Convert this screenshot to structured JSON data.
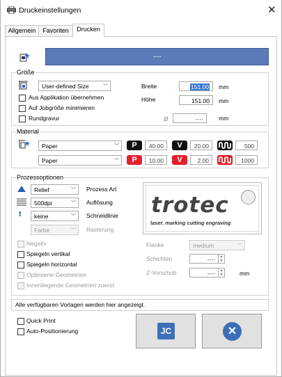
{
  "window": {
    "title": "Druckeinstellungen"
  },
  "tabs": [
    {
      "label": "Allgemein",
      "active": false
    },
    {
      "label": "Favoriten",
      "active": false
    },
    {
      "label": "Drucken",
      "active": true
    }
  ],
  "job": {
    "name": "----"
  },
  "groesse": {
    "title": "Größe",
    "size_preset": "User-defined Size",
    "breite_label": "Breite",
    "breite_value": "151.00",
    "hoehe_label": "Höhe",
    "hoehe_value": "151.00",
    "unit": "mm",
    "rund_symbol": "Ø",
    "rund_value": "----",
    "options": [
      {
        "label": "Aus Applikation übernehmen",
        "checked": false
      },
      {
        "label": "Auf Jobgröße minimieren",
        "checked": false
      },
      {
        "label": "Rundgravur",
        "checked": false
      }
    ]
  },
  "material": {
    "title": "Material",
    "rows": [
      {
        "material": "Paper",
        "p_value": "40.00",
        "v_value": "20.00",
        "ppi_value": "500",
        "color": "black"
      },
      {
        "material": "Paper",
        "p_value": "10.00",
        "v_value": "2.00",
        "ppi_value": "1000",
        "color": "red"
      }
    ],
    "p_letter": "P",
    "v_letter": "V"
  },
  "prozess": {
    "title": "Prozessoptionen",
    "art_value": "Relief",
    "art_label": "Prozess Art",
    "aufl_value": "500dpi",
    "aufl_label": "Auflösung",
    "schneid_value": "keine",
    "schneid_label": "Schneidlinie",
    "farbe_value": "Farbe",
    "raster_label": "Rasterung",
    "checkboxes": [
      {
        "label": "Negativ",
        "checked": false,
        "enabled": false
      },
      {
        "label": "Spiegeln vertikal",
        "checked": false,
        "enabled": true
      },
      {
        "label": "Spiegeln horizontal",
        "checked": false,
        "enabled": true
      },
      {
        "label": "Optimierte Geometrien",
        "checked": false,
        "enabled": false
      },
      {
        "label": "Innenliegende Geometrien zuerst",
        "checked": false,
        "enabled": false
      }
    ],
    "flanke_label": "Flanke",
    "flanke_value": "medium",
    "schichten_label": "Schichten",
    "schichten_value": "----",
    "zvorschub_label": "Z-Vorschub",
    "zvorschub_value": "----",
    "unit": "mm"
  },
  "logo": {
    "text": "trotec",
    "tagline": "laser. marking cutting engraving",
    "seal": "setting new standards"
  },
  "status": "Alle verfügbaren Vorlagen werden hier angezeigt.",
  "bottom": {
    "quick_print": {
      "label": "Quick Print",
      "checked": false
    },
    "auto_pos": {
      "label": "Auto-Positionierung",
      "checked": false
    },
    "ok_icon_text": "JC"
  },
  "colors": {
    "accent_blue": "#5b7bb8",
    "selection": "#3a78d3",
    "badge_black": "#111111",
    "badge_red": "#e4202a"
  }
}
